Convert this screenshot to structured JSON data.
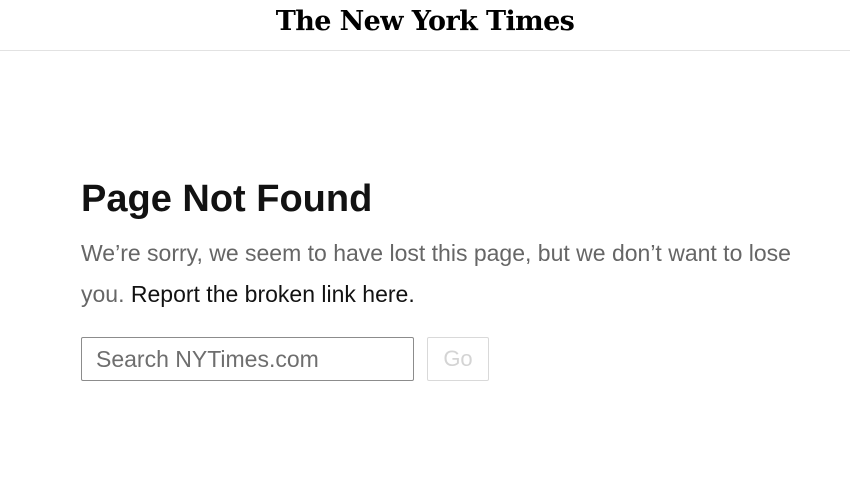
{
  "header": {
    "logo_text": "The New York Times"
  },
  "main": {
    "title": "Page Not Found",
    "message": "We’re sorry, we seem to have lost this page, but we don’t want to lose you.",
    "report_link": "Report the broken link here."
  },
  "search": {
    "placeholder": "Search NYTimes.com",
    "value": "",
    "go_label": "Go",
    "go_disabled": true
  }
}
